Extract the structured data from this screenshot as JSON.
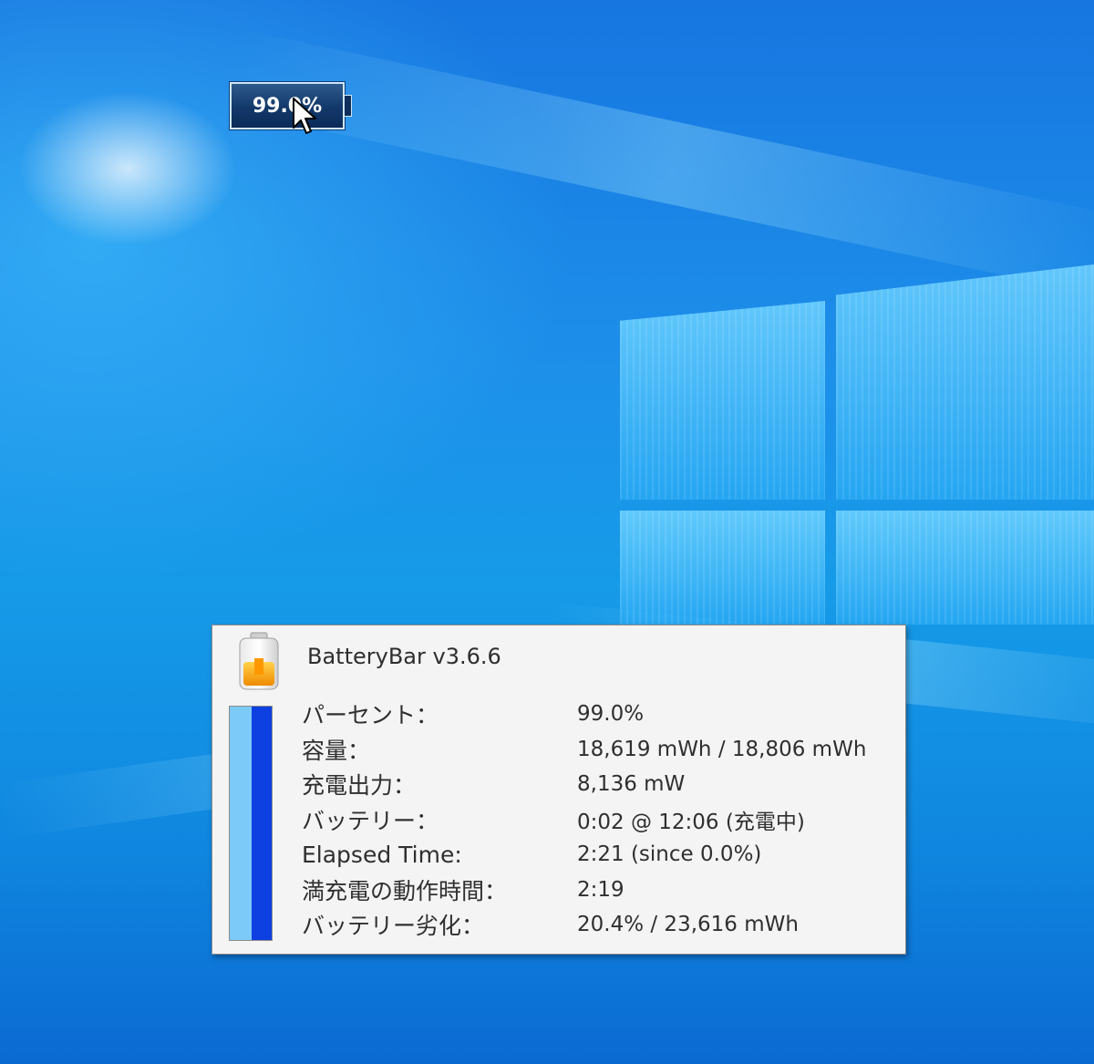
{
  "mini_battery": {
    "percent_text": "99.0%",
    "charge_level": 0.99
  },
  "popup": {
    "title": "BatteryBar v3.6.6",
    "rows": [
      {
        "label": "パーセント：",
        "value": "99.0%"
      },
      {
        "label": "容量：",
        "value": "18,619 mWh / 18,806 mWh"
      },
      {
        "label": "充電出力：",
        "value": "8,136 mW"
      },
      {
        "label": "バッテリー：",
        "value": "0:02 @ 12:06 (充電中)"
      },
      {
        "label": "Elapsed Time:",
        "value": "2:21 (since 0.0%)"
      },
      {
        "label": "満充電の動作時間：",
        "value": "2:19"
      },
      {
        "label": "バッテリー劣化：",
        "value": "20.4% / 23,616 mWh"
      }
    ]
  },
  "colors": {
    "desktop_blue": "#0a66d0",
    "popup_background": "#f4f4f4",
    "level_light": "#7ccaf8",
    "level_dark": "#0e3fe0",
    "mini_battery_fill": "#12386a"
  },
  "icons": {
    "app_icon": "battery-charging-icon",
    "cursor": "mouse-pointer-icon"
  }
}
